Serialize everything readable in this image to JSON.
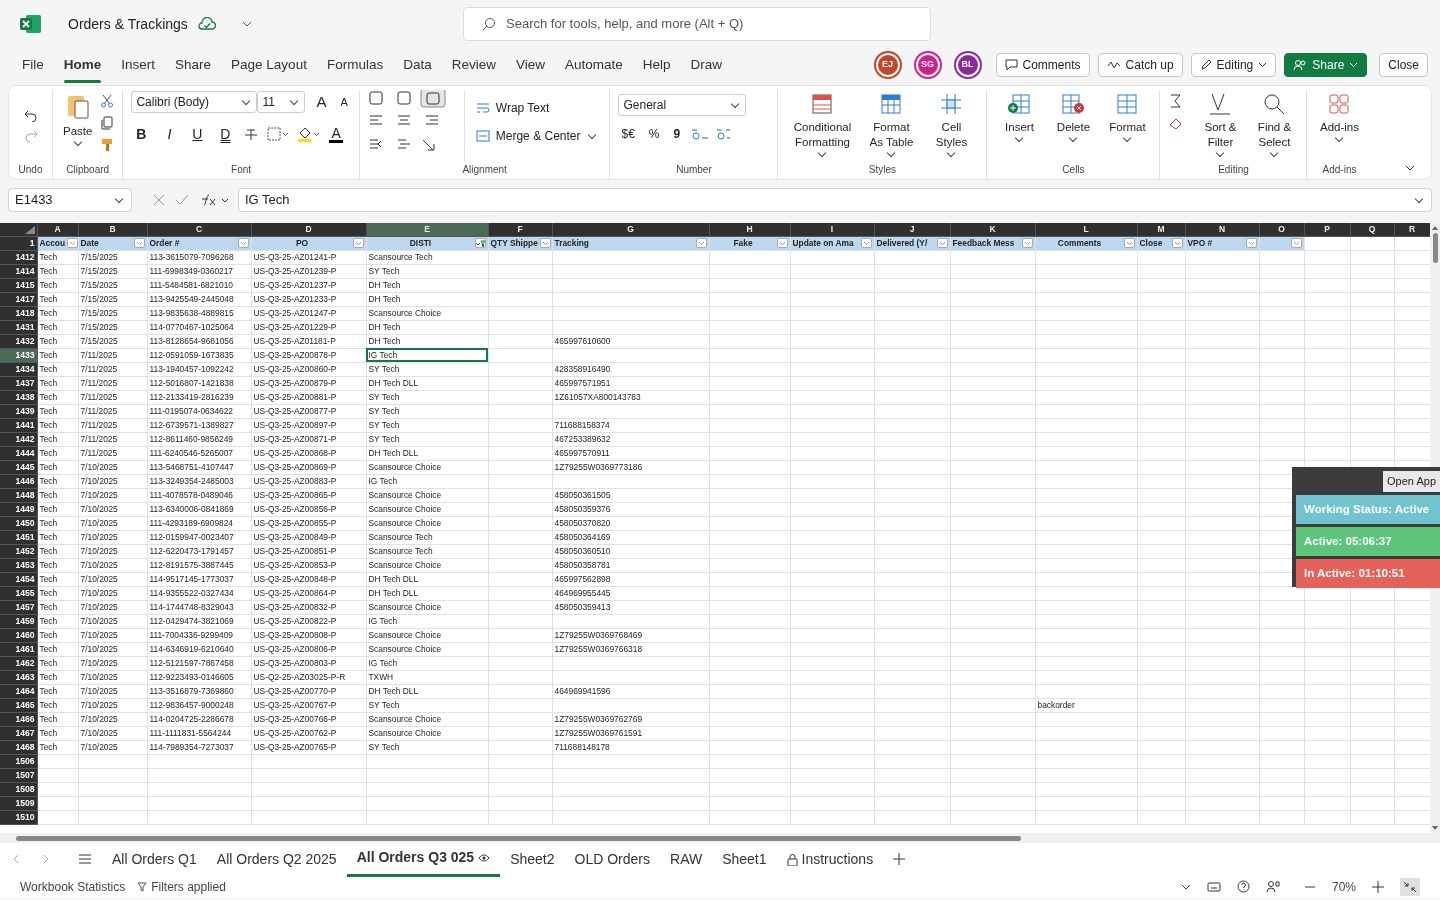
{
  "app": {
    "title": "Orders & Trackings",
    "search_placeholder": "Search for tools, help, and more (Alt + Q)"
  },
  "menu": [
    {
      "label": "File",
      "selected": false
    },
    {
      "label": "Home",
      "selected": true
    },
    {
      "label": "Insert",
      "selected": false
    },
    {
      "label": "Share",
      "selected": false
    },
    {
      "label": "Page Layout",
      "selected": false
    },
    {
      "label": "Formulas",
      "selected": false
    },
    {
      "label": "Data",
      "selected": false
    },
    {
      "label": "Review",
      "selected": false
    },
    {
      "label": "View",
      "selected": false
    },
    {
      "label": "Automate",
      "selected": false
    },
    {
      "label": "Help",
      "selected": false
    },
    {
      "label": "Draw",
      "selected": false
    }
  ],
  "avatars": [
    {
      "initials": "EJ",
      "color": "#c4462a"
    },
    {
      "initials": "SG",
      "color": "#d31f8a"
    },
    {
      "initials": "BL",
      "color": "#8a2a9e"
    }
  ],
  "actions": {
    "comments": "Comments",
    "catch_up": "Catch up",
    "editing": "Editing",
    "share": "Share",
    "close": "Close"
  },
  "ribbon": {
    "undo": {
      "label": "Undo"
    },
    "clipboard": {
      "paste": "Paste",
      "label": "Clipboard"
    },
    "font": {
      "name": "Calibri (Body)",
      "size": "11",
      "grow": "A",
      "shrink": "A",
      "styles": [
        "B",
        "I",
        "U",
        "D"
      ],
      "text_color_glyph": "A",
      "label": "Font"
    },
    "alignment": {
      "wrap": "Wrap Text",
      "merge": "Merge & Center",
      "label": "Alignment"
    },
    "number": {
      "format": "General",
      "currency": "$€",
      "percent": "%",
      "comma": "9",
      "label": "Number"
    },
    "styles": {
      "buttons": [
        "Conditional Formatting",
        "Format As Table",
        "Cell Styles"
      ],
      "label": "Styles"
    },
    "cells": {
      "buttons": [
        "Insert",
        "Delete",
        "Format"
      ],
      "label": "Cells"
    },
    "editing": {
      "buttons": [
        "Sort & Filter",
        "Find & Select"
      ],
      "label": "Editing"
    },
    "addins": {
      "buttons": [
        "Add-ins"
      ],
      "label": "Add-ins"
    }
  },
  "formula_bar": {
    "name_box": "E1433",
    "content": "IG Tech"
  },
  "columns": [
    {
      "letter": "A",
      "selected": false
    },
    {
      "letter": "B",
      "selected": false
    },
    {
      "letter": "C",
      "selected": false
    },
    {
      "letter": "D",
      "selected": false
    },
    {
      "letter": "E",
      "selected": true
    },
    {
      "letter": "F",
      "selected": false
    },
    {
      "letter": "G",
      "selected": false
    },
    {
      "letter": "H",
      "selected": false
    },
    {
      "letter": "I",
      "selected": false
    },
    {
      "letter": "J",
      "selected": false
    },
    {
      "letter": "K",
      "selected": false
    },
    {
      "letter": "L",
      "selected": false
    },
    {
      "letter": "M",
      "selected": false
    },
    {
      "letter": "N",
      "selected": false
    },
    {
      "letter": "O",
      "selected": false
    },
    {
      "letter": "P",
      "selected": false
    },
    {
      "letter": "Q",
      "selected": false
    },
    {
      "letter": "R",
      "selected": false
    }
  ],
  "header_row": {
    "number": "1",
    "headers": [
      {
        "label": "Accou",
        "filtered": false
      },
      {
        "label": "Date",
        "filtered": false
      },
      {
        "label": "Order #",
        "filtered": false
      },
      {
        "label": "PO",
        "filtered": false
      },
      {
        "label": "DISTI",
        "filtered": true
      },
      {
        "label": "QTY Shippe",
        "filtered": false
      },
      {
        "label": "Tracking",
        "filtered": false
      },
      {
        "label": "Fake",
        "filtered": false
      },
      {
        "label": "Update on Ama",
        "filtered": false
      },
      {
        "label": "Delivered (Y/",
        "filtered": false
      },
      {
        "label": "Feedback Mess",
        "filtered": false
      },
      {
        "label": "Comments",
        "filtered": false
      },
      {
        "label": "Close",
        "filtered": false
      },
      {
        "label": "VPO #",
        "filtered": false
      },
      {
        "filtered": false
      }
    ]
  },
  "rows": [
    {
      "number": "1412",
      "selected": false,
      "account": "Tech",
      "date": "7/15/2025",
      "order": "113-3615079-7096268",
      "po": "US-Q3-25-AZ01241-P",
      "disti": "Scansource Tech"
    },
    {
      "number": "1414",
      "selected": false,
      "account": "Tech",
      "date": "7/15/2025",
      "order": "111-6998349-0360217",
      "po": "US-Q3-25-AZ01239-P",
      "disti": "SY Tech"
    },
    {
      "number": "1415",
      "selected": false,
      "account": "Tech",
      "date": "7/15/2025",
      "order": "111-5484581-6821010",
      "po": "US-Q3-25-AZ01237-P",
      "disti": "DH Tech"
    },
    {
      "number": "1417",
      "selected": false,
      "account": "Tech",
      "date": "7/15/2025",
      "order": "113-9425549-2445048",
      "po": "US-Q3-25-AZ01233-P",
      "disti": "DH Tech"
    },
    {
      "number": "1418",
      "selected": false,
      "account": "Tech",
      "date": "7/15/2025",
      "order": "113-9835638-4889815",
      "po": "US-Q3-25-AZ01247-P",
      "disti": "Scansource Choice"
    },
    {
      "number": "1431",
      "selected": false,
      "account": "Tech",
      "date": "7/15/2025",
      "order": "114-0770467-1025064",
      "po": "US-Q3-25-AZ01229-P",
      "disti": "DH Tech"
    },
    {
      "number": "1432",
      "selected": false,
      "account": "Tech",
      "date": "7/15/2025",
      "order": "113-8128654-9681056",
      "po": "US-Q3-25-AZ01181-P",
      "disti": "DH Tech",
      "tracking": "465997610600"
    },
    {
      "number": "1433",
      "selected": true,
      "account": "Tech",
      "date": "7/11/2025",
      "order": "112-0591059-1673835",
      "po": "US-Q3-25-AZ00878-P",
      "disti": "IG Tech"
    },
    {
      "number": "1434",
      "selected": false,
      "account": "Tech",
      "date": "7/11/2025",
      "order": "113-1940457-1092242",
      "po": "US-Q3-25-AZ00860-P",
      "disti": "SY Tech",
      "tracking": "428358916490"
    },
    {
      "number": "1437",
      "selected": false,
      "account": "Tech",
      "date": "7/11/2025",
      "order": "112-5016807-1421838",
      "po": "US-Q3-25-AZ00879-P",
      "disti": "DH Tech DLL",
      "tracking": "465997571951"
    },
    {
      "number": "1438",
      "selected": false,
      "account": "Tech",
      "date": "7/11/2025",
      "order": "112-2133419-2816239",
      "po": "US-Q3-25-AZ00881-P",
      "disti": "SY Tech",
      "tracking": "1Z61057XA800143783"
    },
    {
      "number": "1439",
      "selected": false,
      "account": "Tech",
      "date": "7/11/2025",
      "order": "111-0195074-0634622",
      "po": "US-Q3-25-AZ00877-P",
      "disti": "SY Tech"
    },
    {
      "number": "1441",
      "selected": false,
      "account": "Tech",
      "date": "7/11/2025",
      "order": "112-6739571-1389827",
      "po": "US-Q3-25-AZ00897-P",
      "disti": "SY Tech",
      "tracking": "711688158374"
    },
    {
      "number": "1442",
      "selected": false,
      "account": "Tech",
      "date": "7/11/2025",
      "order": "112-8611460-9856249",
      "po": "US-Q3-25-AZ00871-P",
      "disti": "SY Tech",
      "tracking": "467253389632"
    },
    {
      "number": "1444",
      "selected": false,
      "account": "Tech",
      "date": "7/11/2025",
      "order": "111-6240546-5265007",
      "po": "US-Q3-25-AZ00868-P",
      "disti": "DH Tech DLL",
      "tracking": "465997570911"
    },
    {
      "number": "1445",
      "selected": false,
      "account": "Tech",
      "date": "7/10/2025",
      "order": "113-5468751-4107447",
      "po": "US-Q3-25-AZ00869-P",
      "disti": "Scansource Choice",
      "tracking": "1Z79255W0369773186"
    },
    {
      "number": "1446",
      "selected": false,
      "account": "Tech",
      "date": "7/10/2025",
      "order": "113-3249354-2485003",
      "po": "US-Q3-25-AZ00883-P",
      "disti": "IG Tech"
    },
    {
      "number": "1448",
      "selected": false,
      "account": "Tech",
      "date": "7/10/2025",
      "order": "111-4078578-0489046",
      "po": "US-Q3-25-AZ00865-P",
      "disti": "Scansource Choice",
      "tracking": "458050361505"
    },
    {
      "number": "1449",
      "selected": false,
      "account": "Tech",
      "date": "7/10/2025",
      "order": "113-6340006-0841869",
      "po": "US-Q3-25-AZ00856-P",
      "disti": "Scansource Choice",
      "tracking": "458050359376"
    },
    {
      "number": "1450",
      "selected": false,
      "account": "Tech",
      "date": "7/10/2025",
      "order": "111-4293189-6909824",
      "po": "US-Q3-25-AZ00855-P",
      "disti": "Scansource Choice",
      "tracking": "458050370820"
    },
    {
      "number": "1451",
      "selected": false,
      "account": "Tech",
      "date": "7/10/2025",
      "order": "112-0159947-0023407",
      "po": "US-Q3-25-AZ00849-P",
      "disti": "Scansource Tech",
      "tracking": "458050364169"
    },
    {
      "number": "1452",
      "selected": false,
      "account": "Tech",
      "date": "7/10/2025",
      "order": "112-6220473-1791457",
      "po": "US-Q3-25-AZ00851-P",
      "disti": "Scansource Tech",
      "tracking": "458050360510"
    },
    {
      "number": "1453",
      "selected": false,
      "account": "Tech",
      "date": "7/10/2025",
      "order": "112-8191575-3887445",
      "po": "US-Q3-25-AZ00853-P",
      "disti": "Scansource Choice",
      "tracking": "458050358781"
    },
    {
      "number": "1454",
      "selected": false,
      "account": "Tech",
      "date": "7/10/2025",
      "order": "114-9517145-1773037",
      "po": "US-Q3-25-AZ00848-P",
      "disti": "DH Tech DLL",
      "tracking": "465997562898"
    },
    {
      "number": "1455",
      "selected": false,
      "account": "Tech",
      "date": "7/10/2025",
      "order": "114-9355522-0327434",
      "po": "US-Q3-25-AZ00864-P",
      "disti": "DH Tech DLL",
      "tracking": "464969955445"
    },
    {
      "number": "1457",
      "selected": false,
      "account": "Tech",
      "date": "7/10/2025",
      "order": "114-1744748-8329043",
      "po": "US-Q3-25-AZ00832-P",
      "disti": "Scansource Choice",
      "tracking": "458050359413"
    },
    {
      "number": "1459",
      "selected": false,
      "account": "Tech",
      "date": "7/10/2025",
      "order": "112-0429474-3821069",
      "po": "US-Q3-25-AZ00822-P",
      "disti": "IG Tech"
    },
    {
      "number": "1460",
      "selected": false,
      "account": "Tech",
      "date": "7/10/2025",
      "order": "111-7004336-9299409",
      "po": "US-Q3-25-AZ00808-P",
      "disti": "Scansource Choice",
      "tracking": "1Z79255W0369768469"
    },
    {
      "number": "1461",
      "selected": false,
      "account": "Tech",
      "date": "7/10/2025",
      "order": "114-6346919-6210640",
      "po": "US-Q3-25-AZ00806-P",
      "disti": "Scansource Choice",
      "tracking": "1Z79255W0369766318"
    },
    {
      "number": "1462",
      "selected": false,
      "account": "Tech",
      "date": "7/10/2025",
      "order": "112-5121597-7867458",
      "po": "US-Q3-25-AZ00803-P",
      "disti": "IG Tech"
    },
    {
      "number": "1463",
      "selected": false,
      "account": "Tech",
      "date": "7/10/2025",
      "order": "112-9223493-0146605",
      "po": "US-Q2-25-AZ03025-P-R",
      "disti": "TXWH"
    },
    {
      "number": "1464",
      "selected": false,
      "account": "Tech",
      "date": "7/10/2025",
      "order": "113-3516879-7369860",
      "po": "US-Q3-25-AZ00770-P",
      "disti": "DH Tech DLL",
      "tracking": "464969941596"
    },
    {
      "number": "1465",
      "selected": false,
      "account": "Tech",
      "date": "7/10/2025",
      "order": "112-9836457-9000248",
      "po": "US-Q3-25-AZ00767-P",
      "disti": "SY Tech",
      "comments": "backorder"
    },
    {
      "number": "1466",
      "selected": false,
      "account": "Tech",
      "date": "7/10/2025",
      "order": "114-0204725-2286678",
      "po": "US-Q3-25-AZ00766-P",
      "disti": "Scansource Choice",
      "tracking": "1Z79255W0369762769"
    },
    {
      "number": "1467",
      "selected": false,
      "account": "Tech",
      "date": "7/10/2025",
      "order": "111-1111831-5564244",
      "po": "US-Q3-25-AZ00762-P",
      "disti": "Scansource Choice",
      "tracking": "1Z79255W0369761591"
    },
    {
      "number": "1468",
      "selected": false,
      "account": "Tech",
      "date": "7/10/2025",
      "order": "114-7989354-7273037",
      "po": "US-Q3-25-AZ00765-P",
      "disti": "SY Tech",
      "tracking": "711688148178"
    },
    {
      "number": "1506",
      "selected": false
    },
    {
      "number": "1507",
      "selected": false
    },
    {
      "number": "1508",
      "selected": false
    },
    {
      "number": "1509",
      "selected": false
    },
    {
      "number": "1510",
      "selected": false
    }
  ],
  "status_panel": {
    "open_app": "Open App",
    "working_status": "Working Status: Active",
    "active": "Active: 05:06:37",
    "inactive": "In Active: 01:10:51"
  },
  "sheet_tabs": [
    {
      "label": "All Orders Q1",
      "selected": false
    },
    {
      "label": "All Orders Q2 2025",
      "selected": false
    },
    {
      "label": "All Orders Q3 025",
      "selected": true
    },
    {
      "label": "Sheet2",
      "selected": false
    },
    {
      "label": "OLD Orders",
      "selected": false
    },
    {
      "label": "RAW",
      "selected": false
    },
    {
      "label": "Sheet1",
      "selected": false
    },
    {
      "label": "Instructions",
      "selected": false,
      "locked": true
    }
  ],
  "status_bar": {
    "statistics": "Workbook Statistics",
    "filters": "Filters applied",
    "zoom": "70%"
  }
}
